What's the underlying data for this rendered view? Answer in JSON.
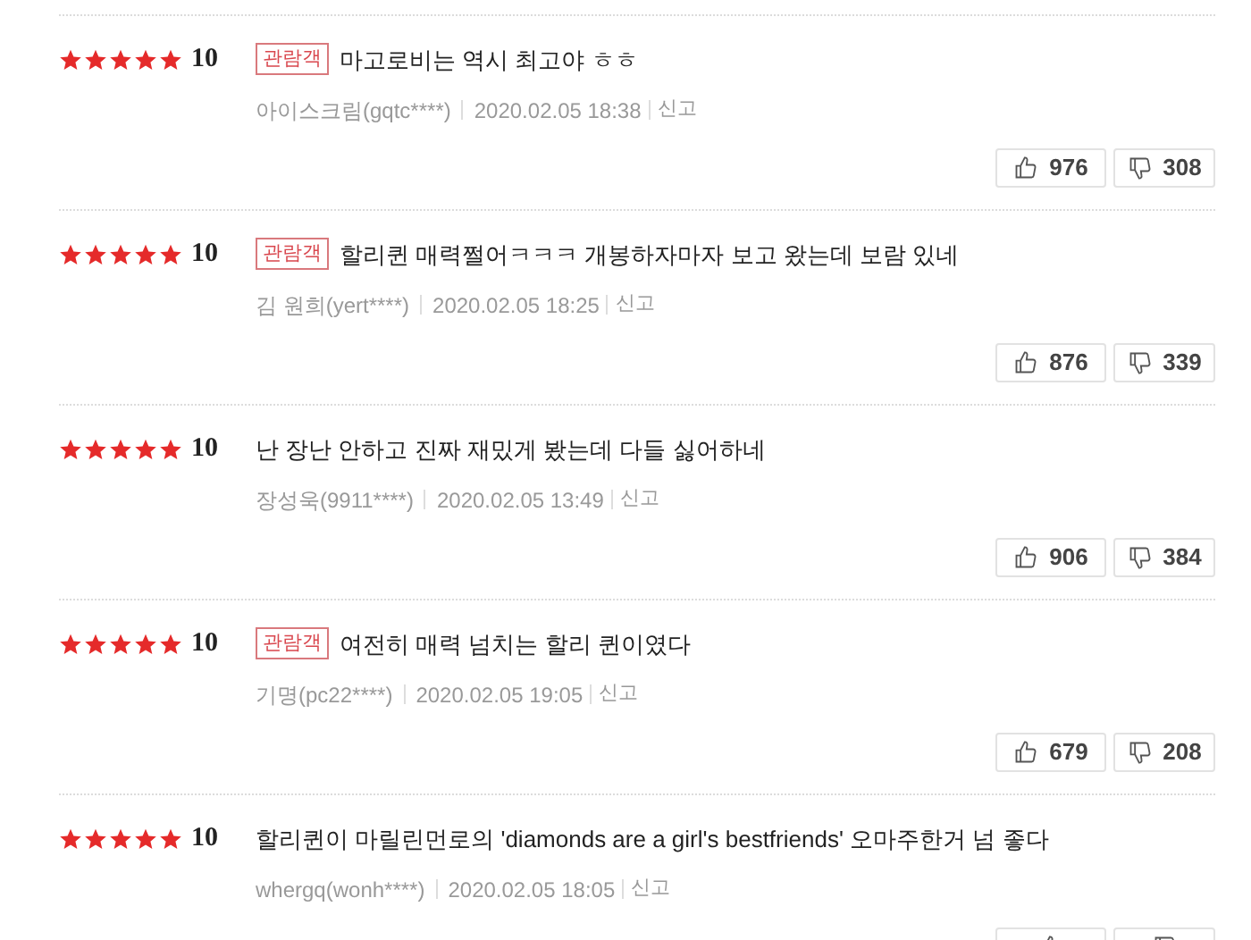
{
  "reviews": [
    {
      "stars": 5,
      "score": "10",
      "badge": "관람객",
      "text": "마고로비는 역시 최고야 ㅎㅎ",
      "author": "아이스크림(gqtc****)",
      "date": "2020.02.05 18:38",
      "report": "신고",
      "likes": "976",
      "dislikes": "308"
    },
    {
      "stars": 5,
      "score": "10",
      "badge": "관람객",
      "text": "할리퀸 매력쩔어ㅋㅋㅋ 개봉하자마자 보고 왔는데 보람 있네",
      "author": "김 원희(yert****)",
      "date": "2020.02.05 18:25",
      "report": "신고",
      "likes": "876",
      "dislikes": "339"
    },
    {
      "stars": 5,
      "score": "10",
      "text": "난 장난 안하고 진짜 재밌게 봤는데 다들 싫어하네",
      "author": "장성욱(9911****)",
      "date": "2020.02.05 13:49",
      "report": "신고",
      "likes": "906",
      "dislikes": "384"
    },
    {
      "stars": 5,
      "score": "10",
      "badge": "관람객",
      "text": "여전히 매력 넘치는 할리 퀸이였다",
      "author": "기명(pc22****)",
      "date": "2020.02.05 19:05",
      "report": "신고",
      "likes": "679",
      "dislikes": "208"
    },
    {
      "stars": 5,
      "score": "10",
      "text": "할리퀸이 마릴린먼로의 'diamonds are a girl's bestfriends' 오마주한거 넘 좋다",
      "author": "whergq(wonh****)",
      "date": "2020.02.05 18:05",
      "report": "신고"
    }
  ]
}
